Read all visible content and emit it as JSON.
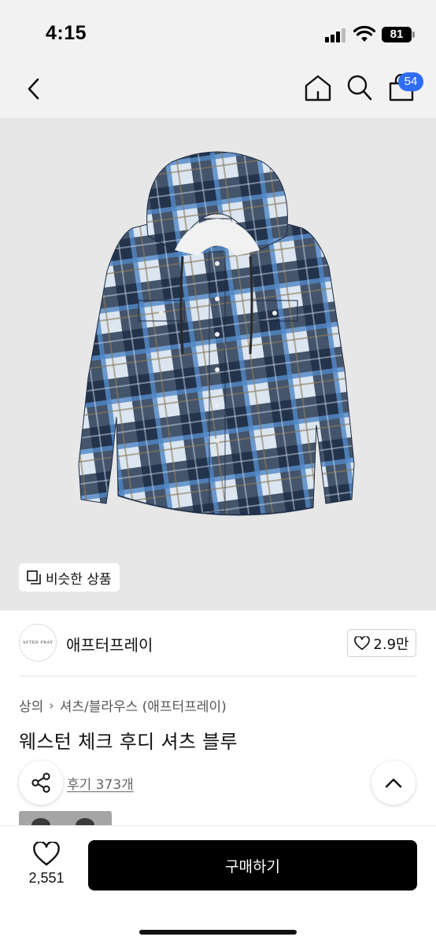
{
  "status_bar": {
    "time": "4:15",
    "battery": "81"
  },
  "nav": {
    "cart_count": "54"
  },
  "image": {
    "similar_label": "비슷한 상품"
  },
  "brand": {
    "name": "애프터프레이",
    "logo_text": "AFTER PRAY",
    "likes": "2.9만"
  },
  "breadcrumb": {
    "category": "상의",
    "separator": "›",
    "subcategory": "셔츠/블라우스 (애프터프레이)"
  },
  "product": {
    "title": "웨스턴 체크 후디 셔츠 블루",
    "review_link": "후기 373개"
  },
  "bottom": {
    "wish_count": "2,551",
    "buy_label": "구매하기"
  },
  "colors": {
    "badge": "#2f6df6",
    "buy_button": "#000000",
    "image_bg": "#e7e7e7",
    "plaid_dark": "#15243a",
    "plaid_blue": "#4f86c6",
    "plaid_light": "#dce6f0"
  }
}
